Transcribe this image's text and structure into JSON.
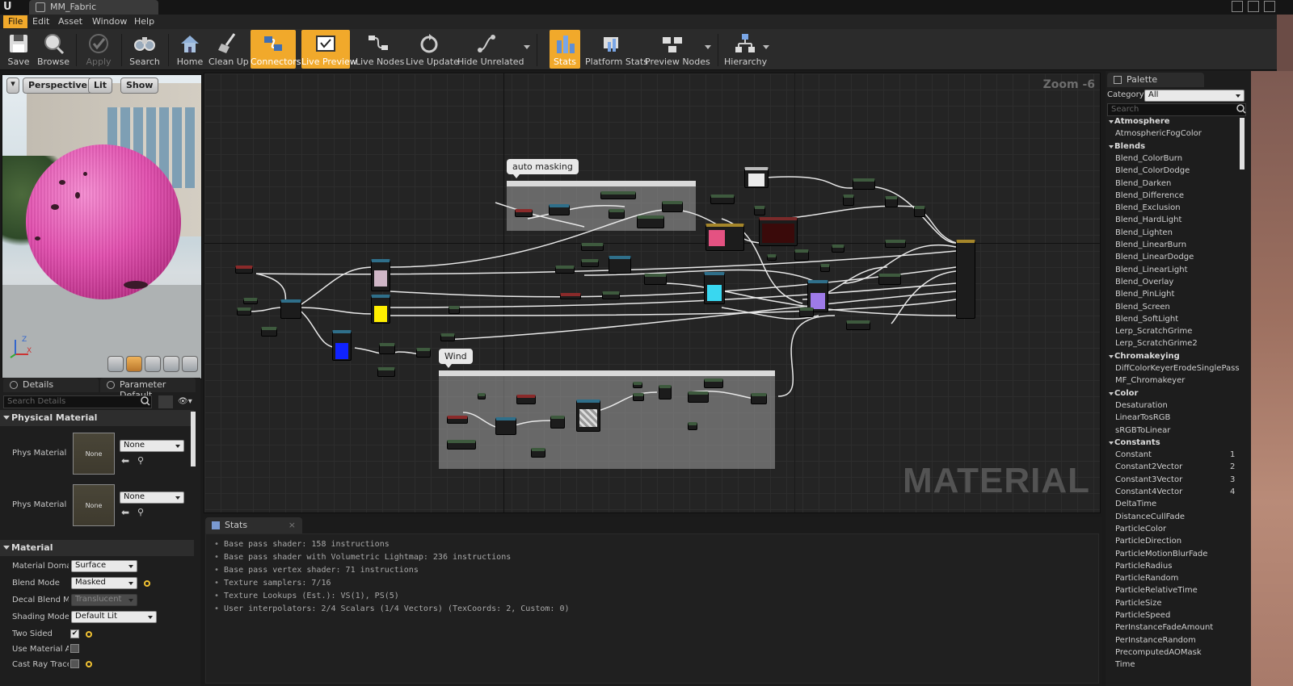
{
  "window": {
    "tab_title": "MM_Fabric"
  },
  "menu": [
    "File",
    "Edit",
    "Asset",
    "Window",
    "Help"
  ],
  "toolbar": {
    "save": "Save",
    "browse": "Browse",
    "apply": "Apply",
    "search": "Search",
    "home": "Home",
    "cleanup": "Clean Up",
    "connectors": "Connectors",
    "live_preview": "Live Preview",
    "live_nodes": "Live Nodes",
    "live_update": "Live Update",
    "hide_unrelated": "Hide Unrelated",
    "stats": "Stats",
    "platform_stats": "Platform Stats",
    "preview_nodes": "Preview Nodes",
    "hierarchy": "Hierarchy"
  },
  "viewport": {
    "perspective": "Perspective",
    "lit": "Lit",
    "show": "Show",
    "axis_z": "Z",
    "axis_x": "X"
  },
  "details": {
    "tab_details": "Details",
    "tab_param": "Parameter Default",
    "search_placeholder": "Search Details",
    "section_physical": "Physical Material",
    "phys_material_label": "Phys Material",
    "phys_material_value": "None",
    "phys_material_thumb": "None",
    "phys_material_mask_label": "Phys Material M",
    "phys_material_mask_value": "None",
    "phys_material_mask_thumb": "None",
    "section_material": "Material",
    "props": [
      {
        "label": "Material Domain",
        "value": "Surface"
      },
      {
        "label": "Blend Mode",
        "value": "Masked"
      },
      {
        "label": "Decal Blend Mod",
        "value": "Translucent"
      },
      {
        "label": "Shading Model",
        "value": "Default Lit"
      },
      {
        "label": "Two Sided",
        "value": ""
      },
      {
        "label": "Use Material Attr",
        "value": ""
      },
      {
        "label": "Cast Ray Traced",
        "value": ""
      }
    ]
  },
  "graph": {
    "zoom": "Zoom -6",
    "watermark": "MATERIAL",
    "comment_auto": "auto masking",
    "comment_wind": "Wind"
  },
  "stats": {
    "tab": "Stats",
    "lines": [
      "Base pass shader: 158 instructions",
      "Base pass shader with Volumetric Lightmap: 236 instructions",
      "Base pass vertex shader: 71 instructions",
      "Texture samplers: 7/16",
      "Texture Lookups (Est.): VS(1), PS(5)",
      "User interpolators: 2/4 Scalars (1/4 Vectors) (TexCoords: 2, Custom: 0)"
    ]
  },
  "palette": {
    "tab": "Palette",
    "category_label": "Category:",
    "category_value": "All",
    "search_placeholder": "Search",
    "entries": [
      {
        "type": "cat",
        "text": "Atmosphere"
      },
      {
        "type": "item",
        "text": "AtmosphericFogColor"
      },
      {
        "type": "cat",
        "text": "Blends"
      },
      {
        "type": "item",
        "text": "Blend_ColorBurn"
      },
      {
        "type": "item",
        "text": "Blend_ColorDodge"
      },
      {
        "type": "item",
        "text": "Blend_Darken"
      },
      {
        "type": "item",
        "text": "Blend_Difference"
      },
      {
        "type": "item",
        "text": "Blend_Exclusion"
      },
      {
        "type": "item",
        "text": "Blend_HardLight"
      },
      {
        "type": "item",
        "text": "Blend_Lighten"
      },
      {
        "type": "item",
        "text": "Blend_LinearBurn"
      },
      {
        "type": "item",
        "text": "Blend_LinearDodge"
      },
      {
        "type": "item",
        "text": "Blend_LinearLight"
      },
      {
        "type": "item",
        "text": "Blend_Overlay"
      },
      {
        "type": "item",
        "text": "Blend_PinLight"
      },
      {
        "type": "item",
        "text": "Blend_Screen"
      },
      {
        "type": "item",
        "text": "Blend_SoftLight"
      },
      {
        "type": "item",
        "text": "Lerp_ScratchGrime"
      },
      {
        "type": "item",
        "text": "Lerp_ScratchGrime2"
      },
      {
        "type": "cat",
        "text": "Chromakeying"
      },
      {
        "type": "item",
        "text": "DiffColorKeyerErodeSinglePass"
      },
      {
        "type": "item",
        "text": "MF_Chromakeyer"
      },
      {
        "type": "cat",
        "text": "Color"
      },
      {
        "type": "item",
        "text": "Desaturation"
      },
      {
        "type": "item",
        "text": "LinearTosRGB"
      },
      {
        "type": "item",
        "text": "sRGBToLinear"
      },
      {
        "type": "cat",
        "text": "Constants"
      },
      {
        "type": "item",
        "text": "Constant",
        "hotkey": "1"
      },
      {
        "type": "item",
        "text": "Constant2Vector",
        "hotkey": "2"
      },
      {
        "type": "item",
        "text": "Constant3Vector",
        "hotkey": "3"
      },
      {
        "type": "item",
        "text": "Constant4Vector",
        "hotkey": "4"
      },
      {
        "type": "item",
        "text": "DeltaTime"
      },
      {
        "type": "item",
        "text": "DistanceCullFade"
      },
      {
        "type": "item",
        "text": "ParticleColor"
      },
      {
        "type": "item",
        "text": "ParticleDirection"
      },
      {
        "type": "item",
        "text": "ParticleMotionBlurFade"
      },
      {
        "type": "item",
        "text": "ParticleRadius"
      },
      {
        "type": "item",
        "text": "ParticleRandom"
      },
      {
        "type": "item",
        "text": "ParticleRelativeTime"
      },
      {
        "type": "item",
        "text": "ParticleSize"
      },
      {
        "type": "item",
        "text": "ParticleSpeed"
      },
      {
        "type": "item",
        "text": "PerInstanceFadeAmount"
      },
      {
        "type": "item",
        "text": "PerInstanceRandom"
      },
      {
        "type": "item",
        "text": "PrecomputedAOMask"
      },
      {
        "type": "item",
        "text": "Time"
      }
    ]
  },
  "colors": {
    "accent": "#f1a92b",
    "bg": "#1a1a1a",
    "panel": "#2b2b2b"
  }
}
